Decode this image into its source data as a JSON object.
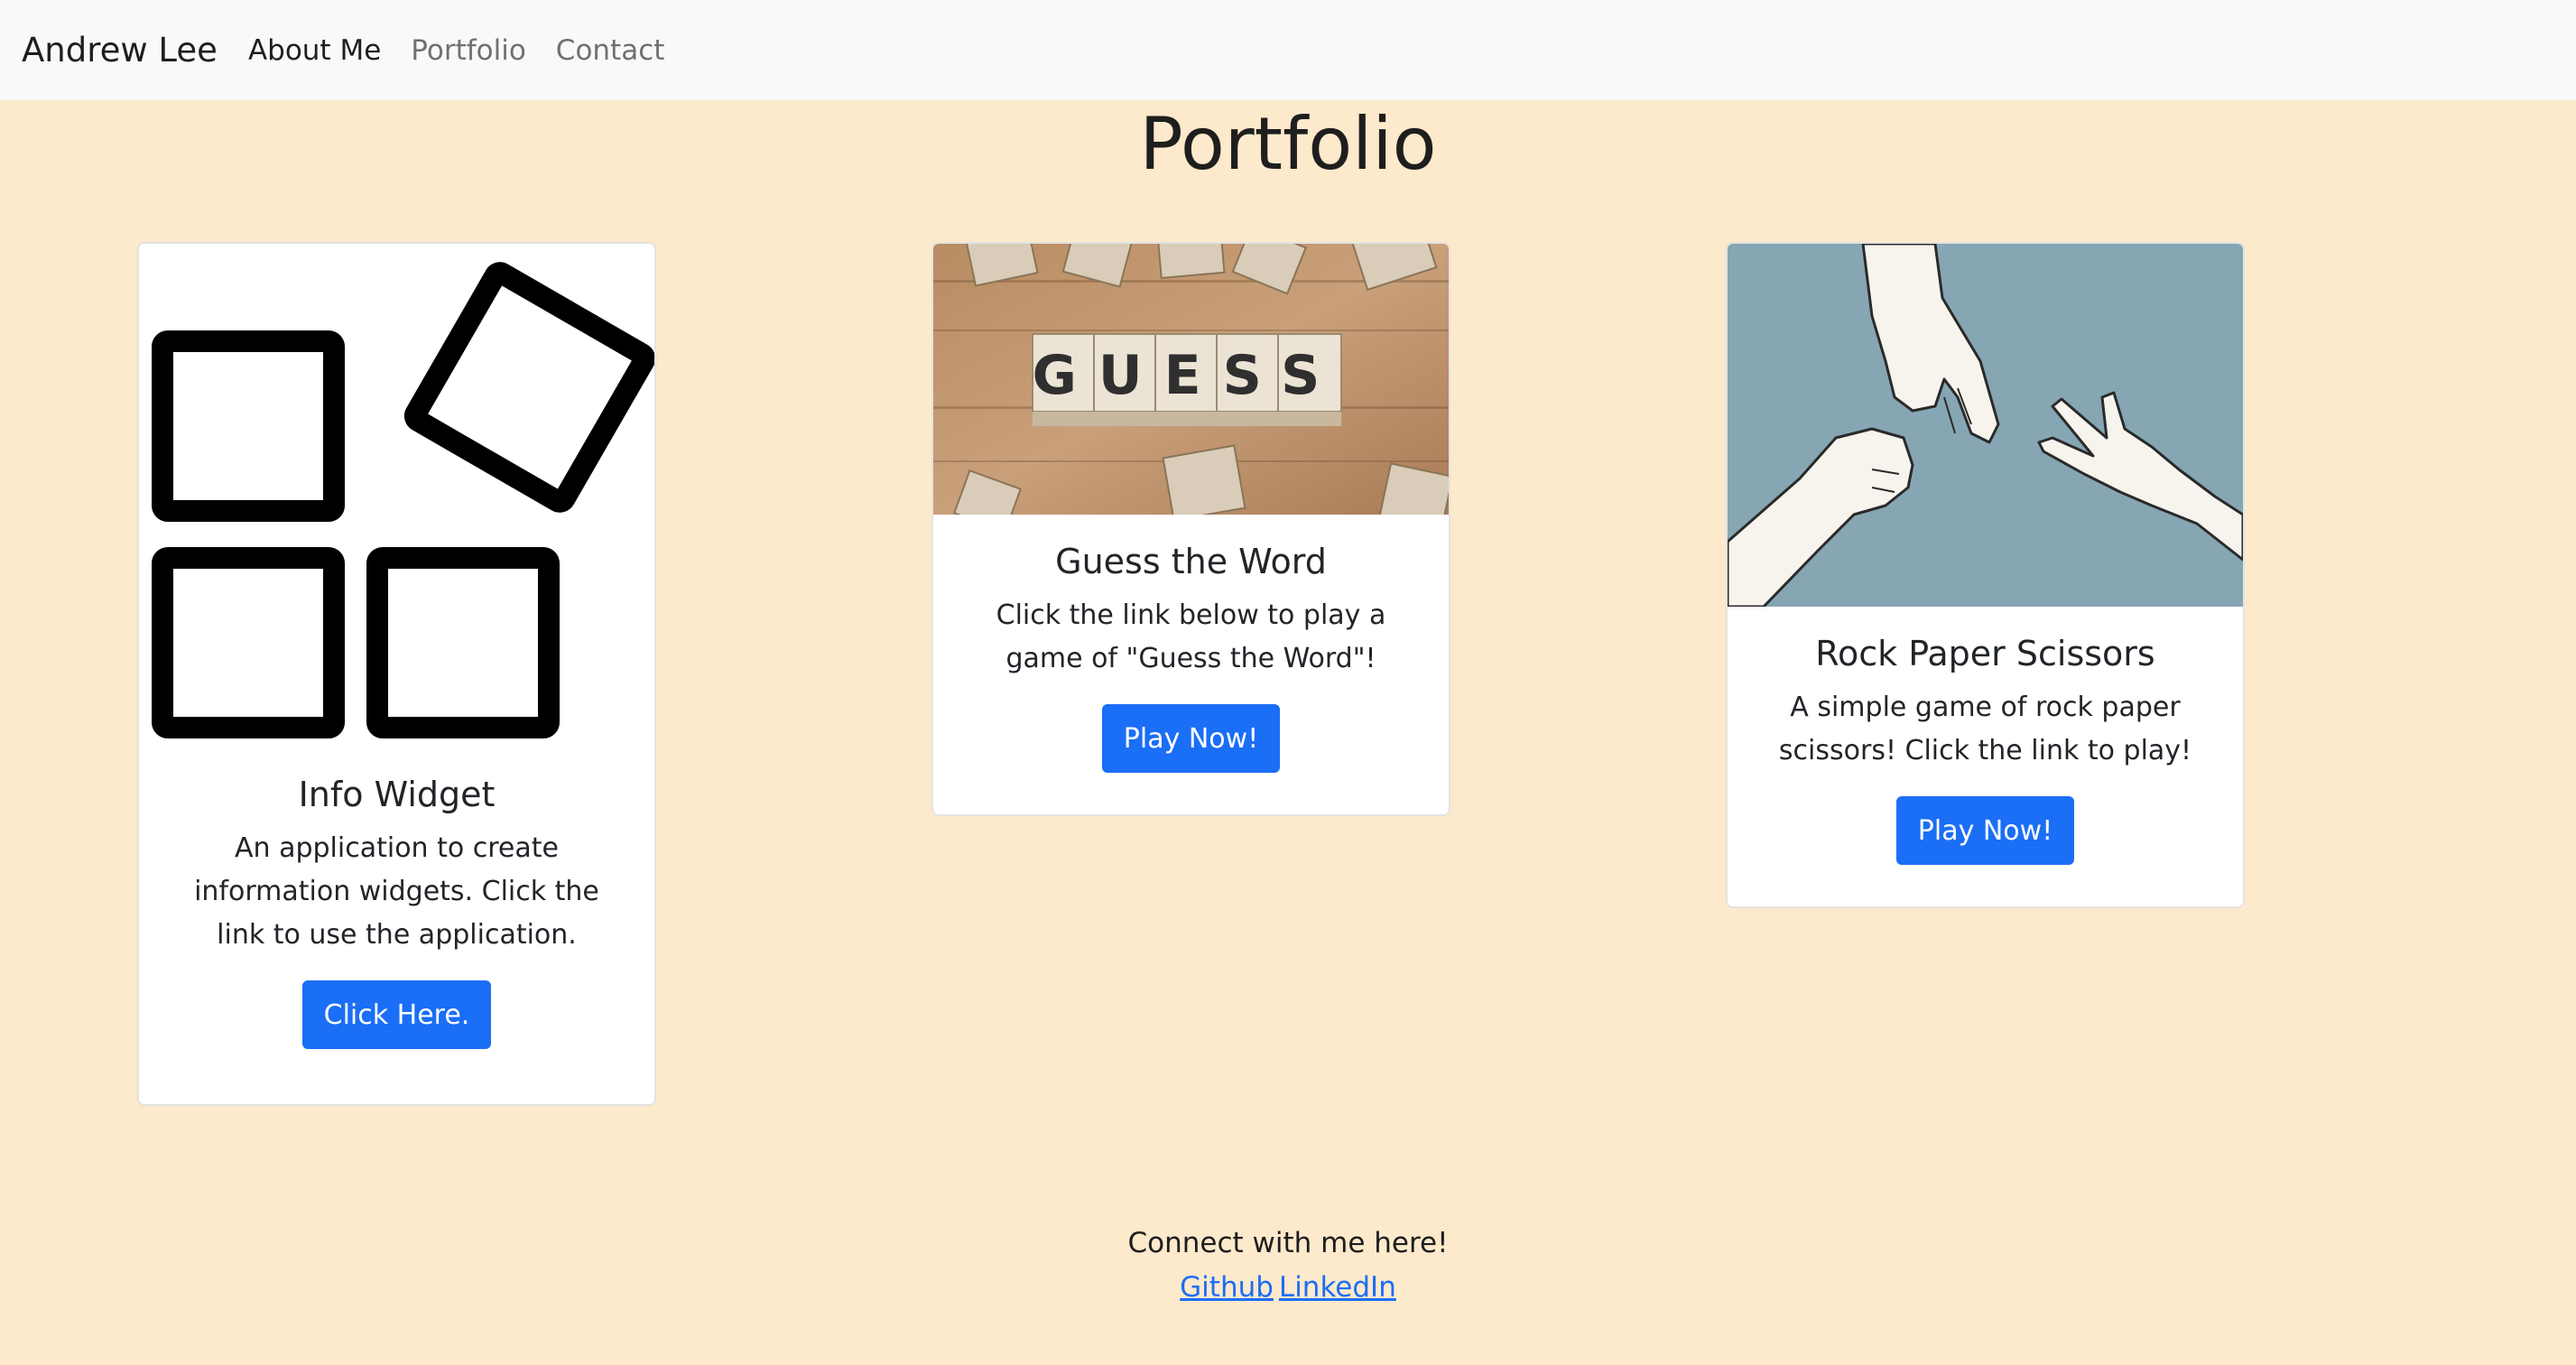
{
  "navbar": {
    "brand": "Andrew Lee",
    "links": [
      "About Me",
      "Portfolio",
      "Contact"
    ]
  },
  "page": {
    "title": "Portfolio"
  },
  "cards": [
    {
      "title": "Info Widget",
      "text": "An application to create information widgets. Click the link to use the application.",
      "button": "Click Here."
    },
    {
      "title": "Guess the Word",
      "text": "Click the link below to play a game of \"Guess the Word\"!",
      "button": "Play Now!",
      "image_text": "GUESS"
    },
    {
      "title": "Rock Paper Scissors",
      "text": "A simple game of rock paper scissors! Click the link to play!",
      "button": "Play Now!"
    }
  ],
  "footer": {
    "text": "Connect with me here!",
    "links": [
      "Github",
      "LinkedIn"
    ]
  },
  "colors": {
    "background": "#fde9cb",
    "navbar": "#f8f9fa",
    "primary_button": "#1b6ef6",
    "link": "#1b6ef6"
  }
}
